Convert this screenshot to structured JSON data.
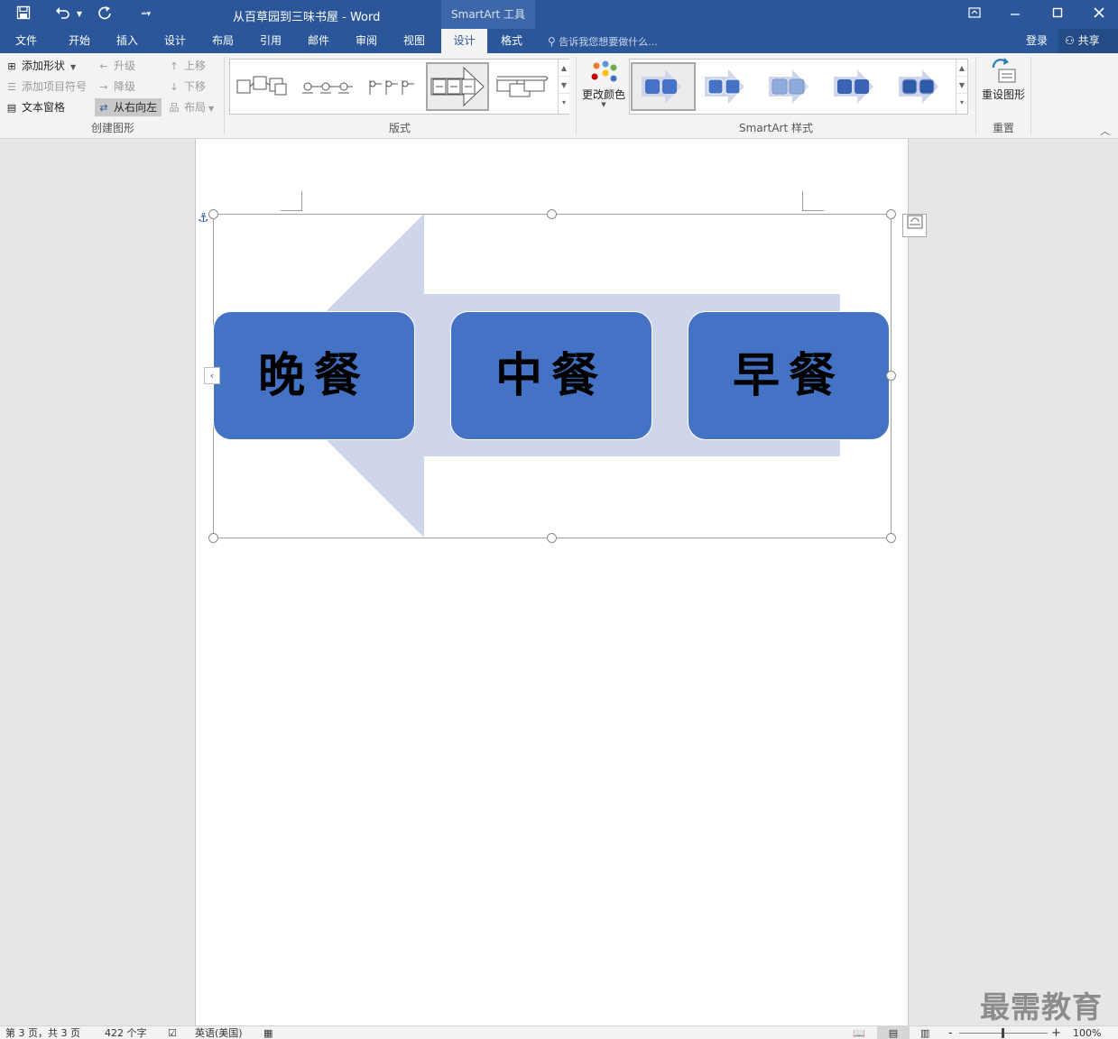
{
  "app": {
    "document_title": "从百草园到三味书屋 - Word",
    "context_tab": "SmartArt 工具",
    "quick_access": {
      "save_icon": "save-icon",
      "undo_icon": "undo-icon",
      "redo_icon": "redo-icon",
      "customize_icon": "customize-quick-access-icon"
    },
    "window_buttons": {
      "ribbon_options_icon": "ribbon-display-options-icon",
      "minimize_icon": "minimize-icon",
      "maximize_icon": "maximize-icon",
      "close_icon": "close-icon"
    }
  },
  "tabs": [
    {
      "label": "文件",
      "active": false
    },
    {
      "label": "开始",
      "active": false
    },
    {
      "label": "插入",
      "active": false
    },
    {
      "label": "设计",
      "active": false
    },
    {
      "label": "布局",
      "active": false
    },
    {
      "label": "引用",
      "active": false
    },
    {
      "label": "邮件",
      "active": false
    },
    {
      "label": "审阅",
      "active": false
    },
    {
      "label": "视图",
      "active": false
    },
    {
      "label": "设计",
      "active": true
    },
    {
      "label": "格式",
      "active": false
    }
  ],
  "tell_me": "告诉我您想要做什么...",
  "sign_in": "登录",
  "share": "共享",
  "ribbon": {
    "create_graphic": {
      "label": "创建图形",
      "add_shape": "添加形状",
      "add_bullet": "添加项目符号",
      "text_pane": "文本窗格",
      "promote": "升级",
      "demote": "降级",
      "right_to_left": "从右向左",
      "move_up": "上移",
      "move_down": "下移",
      "layout": "布局"
    },
    "layouts": {
      "label": "版式"
    },
    "smartart_styles": {
      "label": "SmartArt 样式",
      "change_colors": "更改颜色"
    },
    "reset": {
      "label": "重置",
      "reset_graphic": "重设图形"
    }
  },
  "smartart": {
    "accent_color": "#4472c4",
    "arrow_color": "#cfd5ea",
    "boxes": [
      "晚餐",
      "中餐",
      "早餐"
    ]
  },
  "watermark": "最需教育",
  "status": {
    "page": "第 3 页，共 3 页",
    "words": "422 个字",
    "language": "英语(美国)",
    "zoom": "100%",
    "zoom_minus": "-",
    "zoom_plus": "+"
  }
}
